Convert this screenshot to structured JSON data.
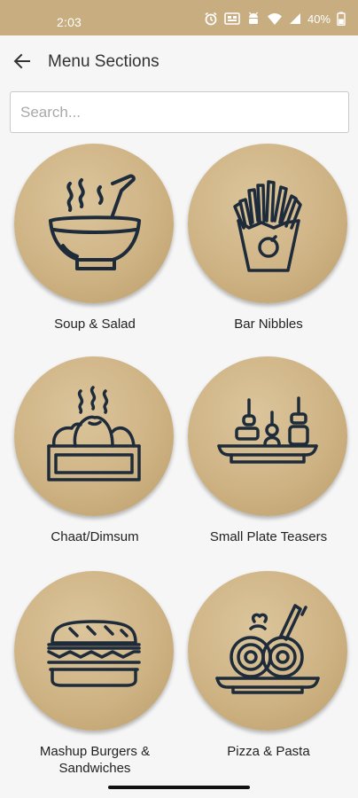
{
  "status_bar": {
    "time": "2:03",
    "battery": "40%",
    "icons": [
      "alarm-icon",
      "cast-icon",
      "android-icon",
      "wifi-icon",
      "signal-icon",
      "battery-icon"
    ],
    "background": "#c8ad81"
  },
  "app_bar": {
    "title": "Menu Sections",
    "back_icon": "arrow-left-icon"
  },
  "search": {
    "placeholder": "Search...",
    "value": ""
  },
  "sections": [
    {
      "label": "Soup & Salad",
      "icon": "soup-bowl-icon"
    },
    {
      "label": "Bar Nibbles",
      "icon": "french-fries-icon"
    },
    {
      "label": "Chaat/Dimsum",
      "icon": "dimsum-steamer-icon"
    },
    {
      "label": "Small Plate Teasers",
      "icon": "skewer-plate-icon"
    },
    {
      "label": "Mashup Burgers & Sandwiches",
      "icon": "sandwich-icon"
    },
    {
      "label": "Pizza & Pasta",
      "icon": "pasta-plate-icon"
    }
  ],
  "colors": {
    "accent": "#c8ad81",
    "icon_stroke": "#1d2b3a",
    "background": "#f6f6f6"
  }
}
